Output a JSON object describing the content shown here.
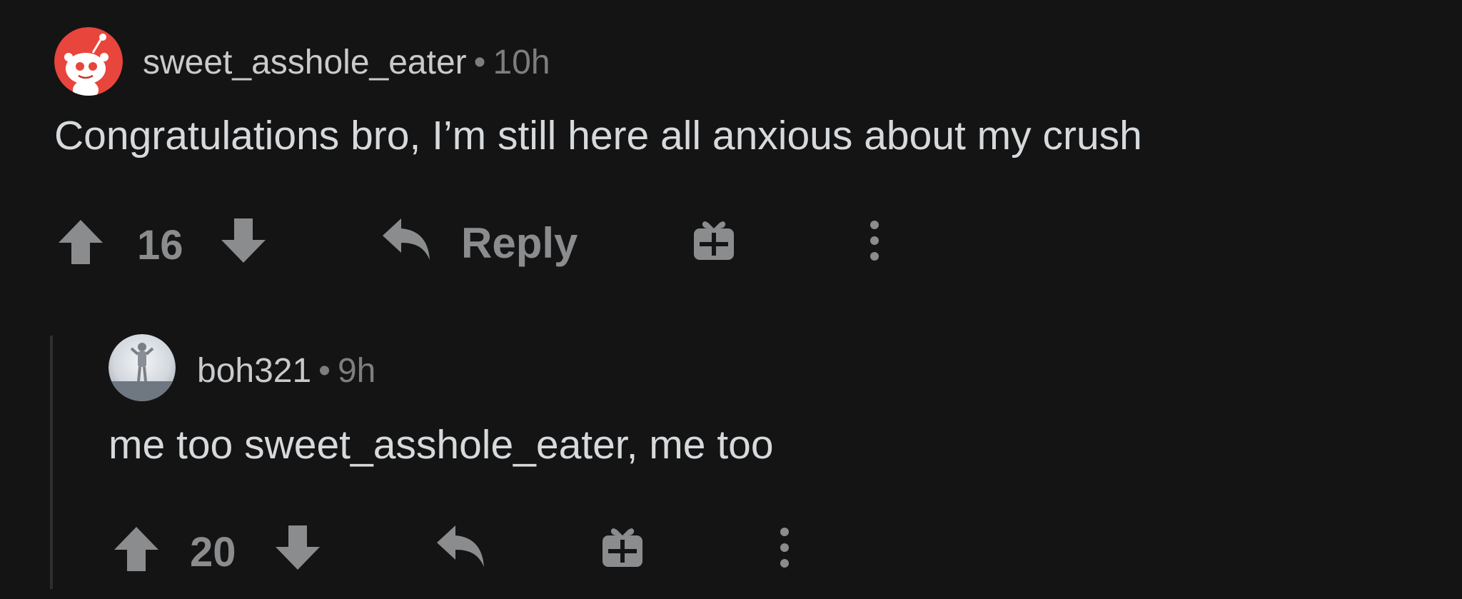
{
  "comments": [
    {
      "username": "sweet_asshole_eater",
      "separator": "•",
      "time": "10h",
      "body": "Congratulations bro, I’m still here all anxious about my crush",
      "votes": "16",
      "reply_label": "Reply"
    },
    {
      "username": "boh321",
      "separator": "•",
      "time": "9h",
      "body": "me too sweet_asshole_eater, me too",
      "votes": "20"
    }
  ],
  "colors": {
    "background": "#141414",
    "text": "#d7dadc",
    "muted": "#8a8c8e",
    "avatar_red": "#ff4500"
  }
}
